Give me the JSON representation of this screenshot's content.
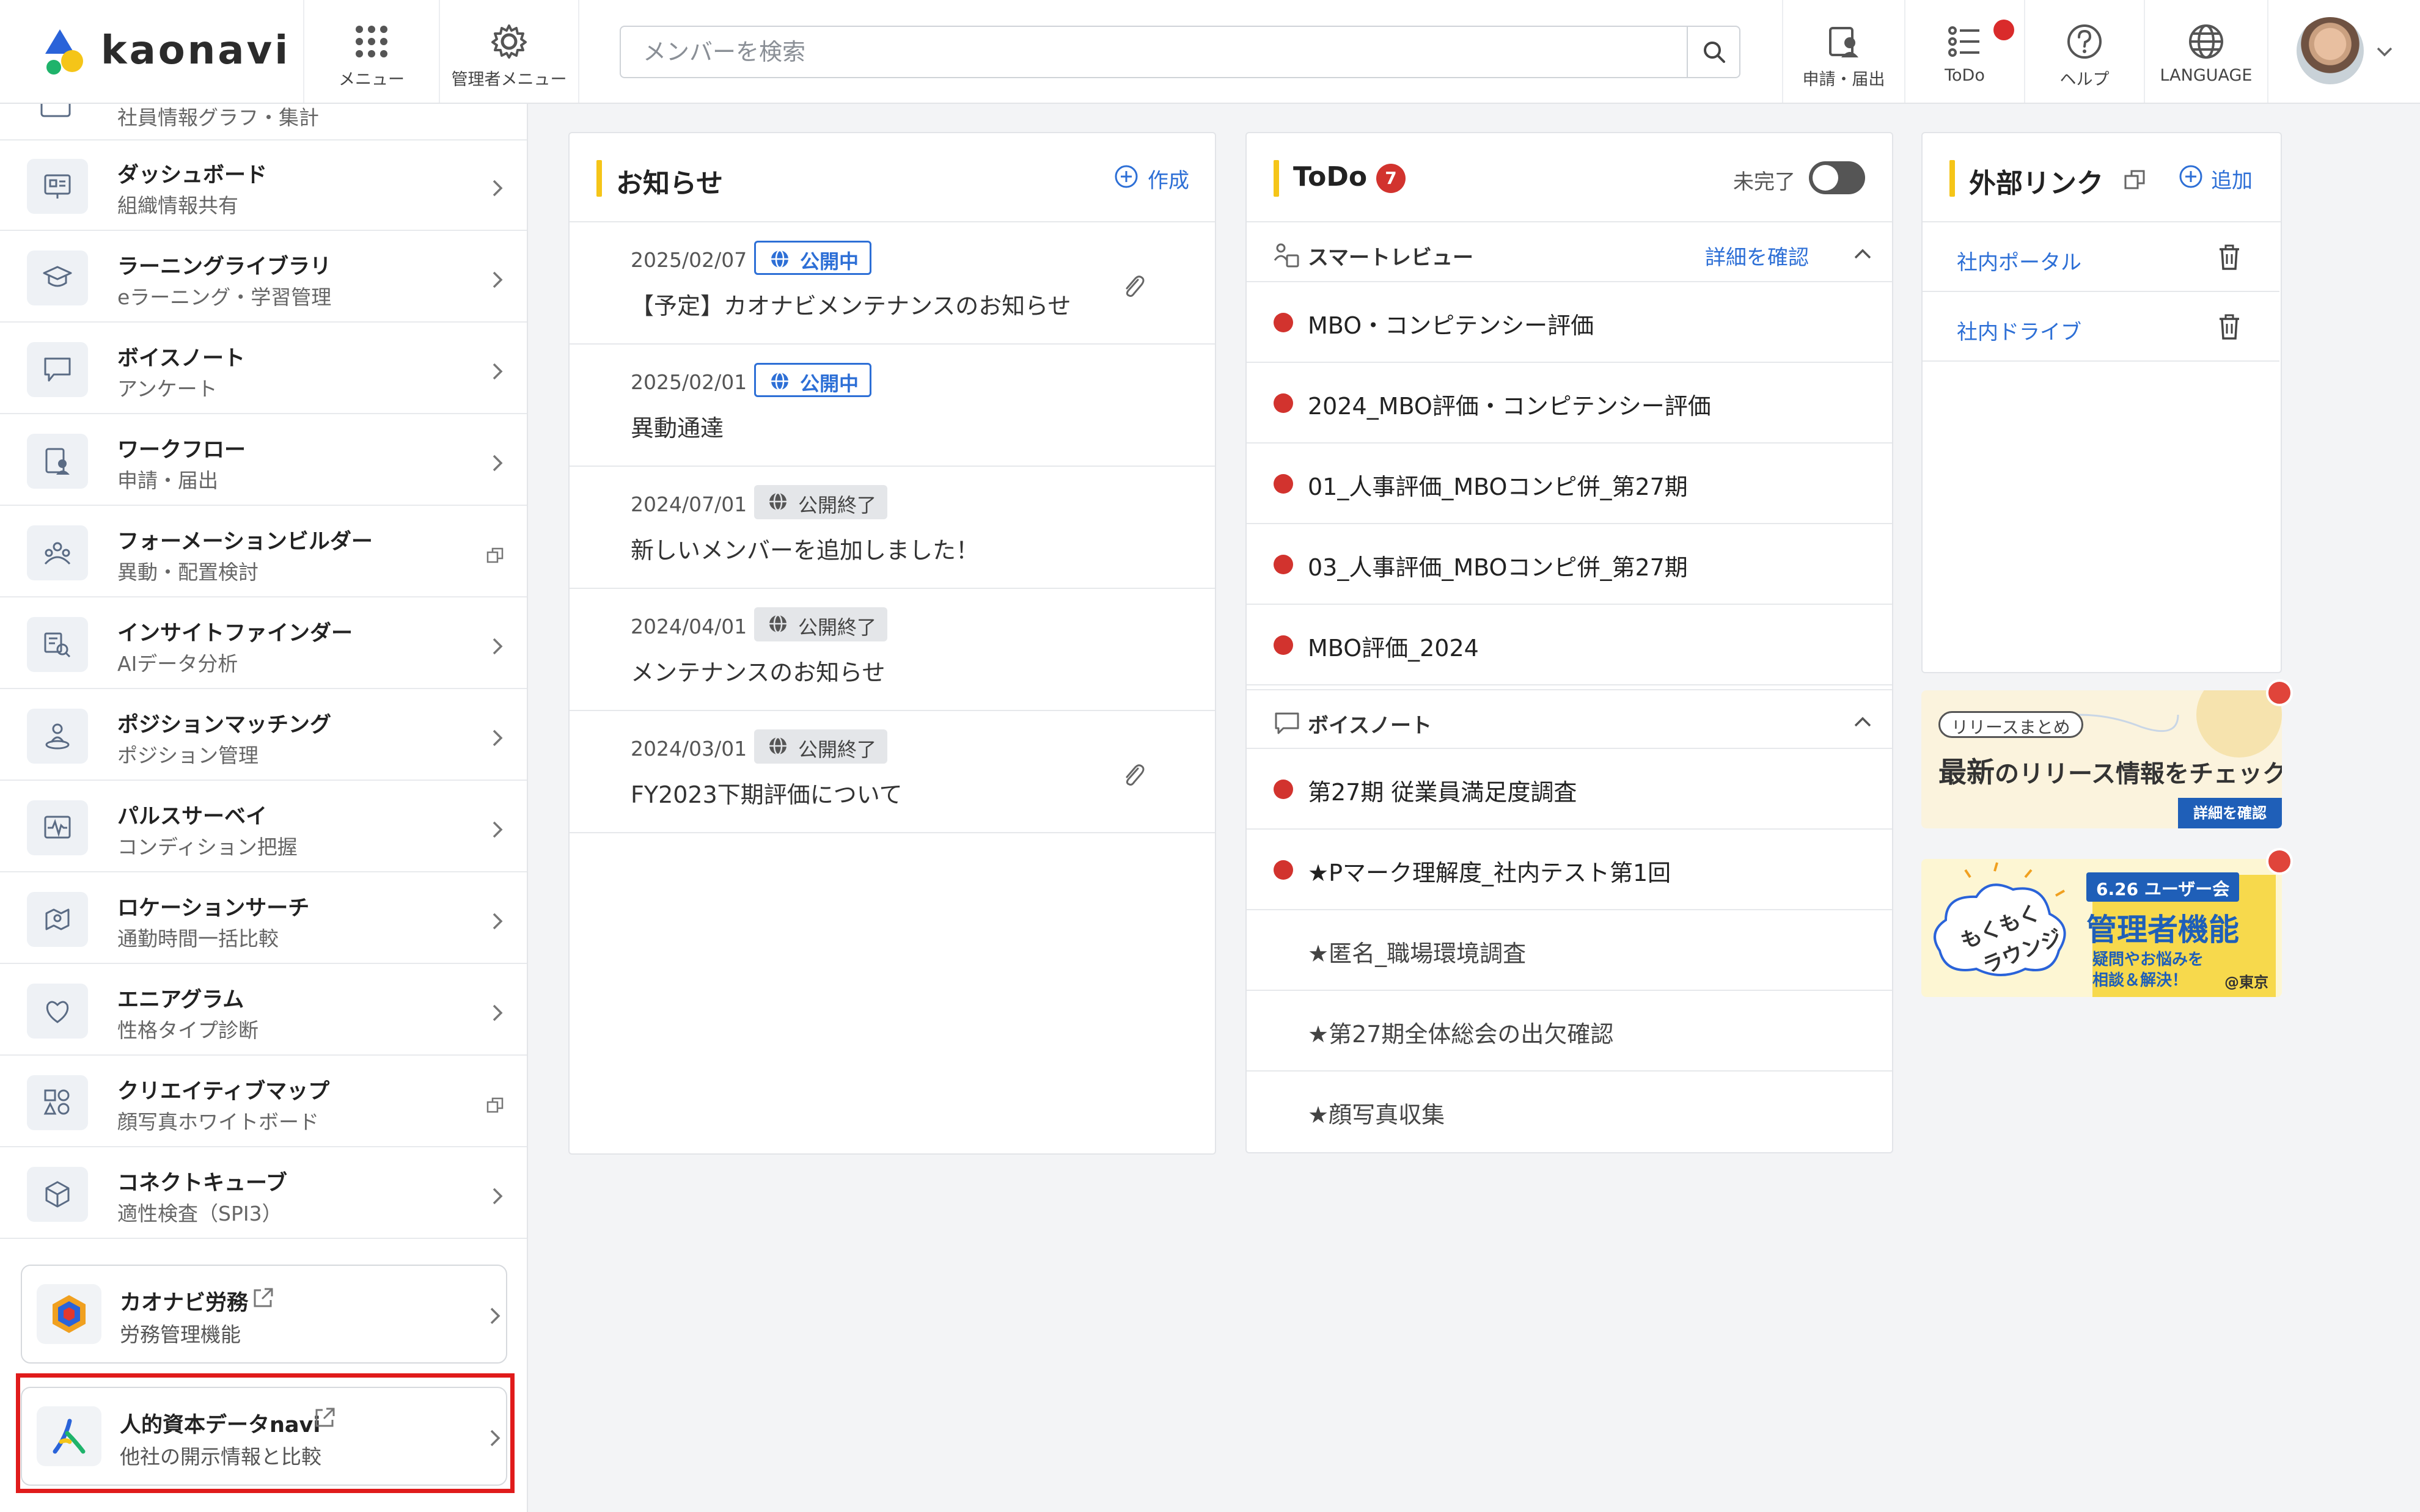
{
  "header": {
    "logo_text": "kaonavi",
    "menu_label": "メニュー",
    "admin_menu_label": "管理者メニュー",
    "search_placeholder": "メンバーを検索",
    "workflow_label": "申請・届出",
    "todo_label": "ToDo",
    "help_label": "ヘルプ",
    "language_label": "LANGUAGE"
  },
  "sidebar": {
    "partial_item_label": "社員情報グラフ・集計",
    "items": [
      {
        "title": "ダッシュボード",
        "subtitle": "組織情報共有",
        "icon": "dashboard-icon",
        "external": false
      },
      {
        "title": "ラーニングライブラリ",
        "subtitle": "eラーニング・学習管理",
        "icon": "graduation-cap-icon",
        "external": false
      },
      {
        "title": "ボイスノート",
        "subtitle": "アンケート",
        "icon": "speech-bubble-icon",
        "external": false
      },
      {
        "title": "ワークフロー",
        "subtitle": "申請・届出",
        "icon": "workflow-icon",
        "external": false
      },
      {
        "title": "フォーメーションビルダー",
        "subtitle": "異動・配置検討",
        "icon": "formation-icon",
        "external": true
      },
      {
        "title": "インサイトファインダー",
        "subtitle": "AIデータ分析",
        "icon": "insight-icon",
        "external": false
      },
      {
        "title": "ポジションマッチング",
        "subtitle": "ポジション管理",
        "icon": "position-icon",
        "external": false
      },
      {
        "title": "パルスサーベイ",
        "subtitle": "コンディション把握",
        "icon": "pulse-icon",
        "external": false
      },
      {
        "title": "ロケーションサーチ",
        "subtitle": "通勤時間一括比較",
        "icon": "location-icon",
        "external": false
      },
      {
        "title": "エニアグラム",
        "subtitle": "性格タイプ診断",
        "icon": "enneagram-icon",
        "external": false
      },
      {
        "title": "クリエイティブマップ",
        "subtitle": "顔写真ホワイトボード",
        "icon": "shapes-icon",
        "external": true
      },
      {
        "title": "コネクトキューブ",
        "subtitle": "適性検査（SPI3）",
        "icon": "cube-icon",
        "external": false
      }
    ],
    "cards": [
      {
        "title": "カオナビ労務",
        "subtitle": "労務管理機能"
      },
      {
        "title": "人的資本データnavi",
        "subtitle": "他社の開示情報と比較"
      }
    ]
  },
  "news": {
    "title": "お知らせ",
    "create_label": "作成",
    "items": [
      {
        "date": "2025/02/07",
        "status": "公開中",
        "published": true,
        "text": "【予定】カオナビメンテナンスのお知らせ",
        "attachment": true
      },
      {
        "date": "2025/02/01",
        "status": "公開中",
        "published": true,
        "text": "異動通達",
        "attachment": false
      },
      {
        "date": "2024/07/01",
        "status": "公開終了",
        "published": false,
        "text": "新しいメンバーを追加しました！",
        "attachment": false
      },
      {
        "date": "2024/04/01",
        "status": "公開終了",
        "published": false,
        "text": "メンテナンスのお知らせ",
        "attachment": false
      },
      {
        "date": "2024/03/01",
        "status": "公開終了",
        "published": false,
        "text": "FY2023下期評価について",
        "attachment": true
      }
    ]
  },
  "todo": {
    "title": "ToDo",
    "count": "7",
    "toggle_label": "未完了",
    "smart_review": {
      "label": "スマートレビュー",
      "detail_link": "詳細を確認",
      "items": [
        "MBO・コンピテンシー評価",
        "2024_MBO評価・コンピテンシー評価",
        "01_人事評価_MBOコンピ併_第27期",
        "03_人事評価_MBOコンピ併_第27期",
        "MBO評価_2024"
      ]
    },
    "voice_note": {
      "label": "ボイスノート",
      "items": [
        {
          "text": "第27期 従業員満足度調査",
          "unread": true
        },
        {
          "text": "★Pマーク理解度_社内テスト第1回",
          "unread": true
        },
        {
          "text": "★匿名_職場環境調査",
          "unread": false
        },
        {
          "text": "★第27期全体総会の出欠確認",
          "unread": false
        },
        {
          "text": "★顔写真収集",
          "unread": false
        }
      ]
    }
  },
  "external_links": {
    "title": "外部リンク",
    "add_label": "追加",
    "items": [
      "社内ポータル",
      "社内ドライブ"
    ]
  },
  "banners": {
    "release": {
      "tag": "リリースまとめ",
      "headline_strong": "最新",
      "headline_rest": "のリリース情報をチェック",
      "button": "詳細を確認"
    },
    "lounge": {
      "badge": "6.26 ユーザー会",
      "title": "管理者機能",
      "sub1": "疑問やお悩みを",
      "sub2": "相談＆解決！",
      "place": "@東京",
      "left_text1": "もくもく",
      "left_text2": "ラウンジ"
    }
  },
  "colors": {
    "accent_yellow": "#f5c518",
    "link_blue": "#2d6fd6",
    "alert_red": "#d2332e",
    "highlight_red": "#e01b1b"
  }
}
